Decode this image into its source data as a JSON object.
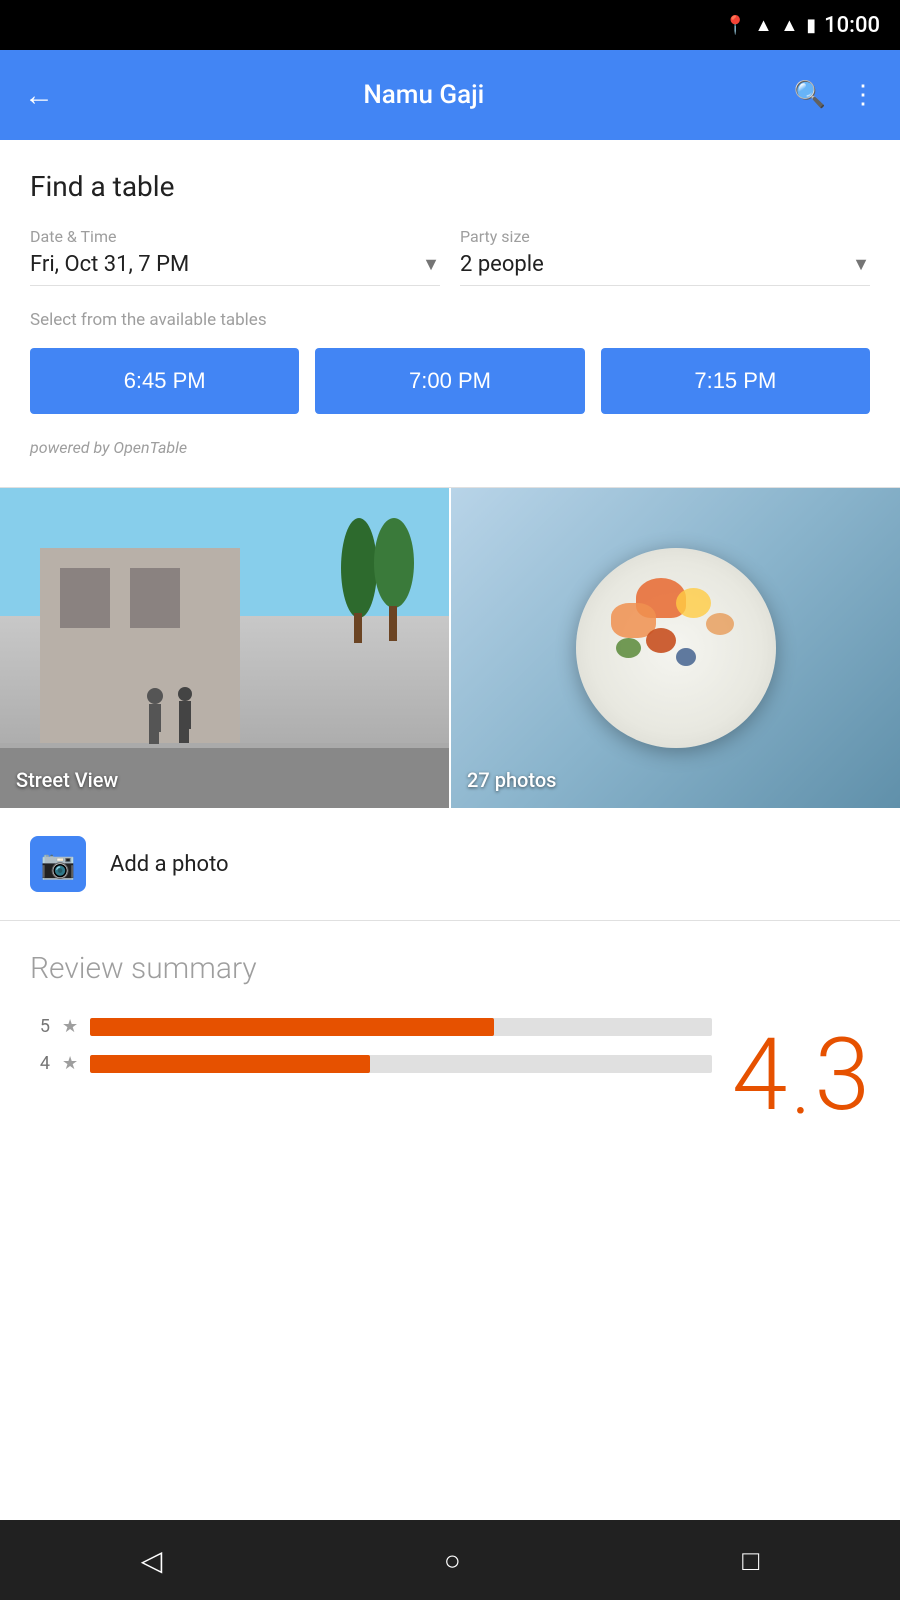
{
  "statusBar": {
    "time": "10:00",
    "icons": [
      "location",
      "wifi",
      "signal",
      "battery"
    ]
  },
  "appBar": {
    "back_label": "←",
    "title": "Namu Gaji",
    "search_label": "🔍",
    "more_label": "⋮"
  },
  "findTable": {
    "section_title": "Find a table",
    "date_label": "Date & Time",
    "date_value": "Fri, Oct 31, 7 PM",
    "party_label": "Party size",
    "party_value": "2 people",
    "available_label": "Select from the available tables",
    "time_slots": [
      "6:45 PM",
      "7:00 PM",
      "7:15 PM"
    ],
    "powered_by": "powered by OpenTable"
  },
  "photos": {
    "street_view_label": "Street View",
    "photos_label": "27 photos",
    "add_photo_label": "Add a photo"
  },
  "reviewSummary": {
    "title": "Review summary",
    "rating_display": "4.3",
    "rating_integer": "4",
    "rating_decimal": "3",
    "bars": [
      {
        "stars": 5,
        "percent": 65
      },
      {
        "stars": 4,
        "percent": 45
      }
    ]
  },
  "bottomNav": {
    "back_label": "◁",
    "home_label": "○",
    "recent_label": "□"
  }
}
